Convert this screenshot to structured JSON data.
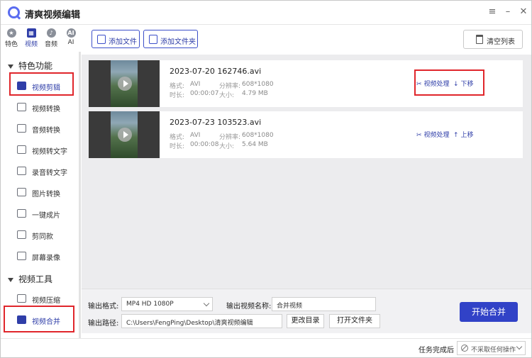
{
  "app": {
    "title": "清爽视频编辑"
  },
  "top_tabs": [
    {
      "label": "特色",
      "icon": "star-icon"
    },
    {
      "label": "视频",
      "icon": "video-icon"
    },
    {
      "label": "音频",
      "icon": "audio-icon"
    },
    {
      "label": "AI",
      "icon": "ai-icon"
    }
  ],
  "sidebar": {
    "sections": [
      {
        "title": "特色功能"
      },
      {
        "title": "视频工具"
      }
    ],
    "features": [
      {
        "label": "视频剪辑"
      },
      {
        "label": "视频转换"
      },
      {
        "label": "音频转换"
      },
      {
        "label": "视频转文字"
      },
      {
        "label": "录音转文字"
      },
      {
        "label": "图片转换"
      },
      {
        "label": "一键成片"
      },
      {
        "label": "剪同款"
      },
      {
        "label": "屏幕录像"
      }
    ],
    "tools": [
      {
        "label": "视频压缩"
      },
      {
        "label": "视频合并"
      }
    ]
  },
  "toolbar": {
    "add_file": "添加文件",
    "add_folder": "添加文件夹",
    "clear_list": "清空列表"
  },
  "files": [
    {
      "name": "2023-07-20 162746.avi",
      "format_label": "格式:",
      "format": "AVI",
      "res_label": "分辨率:",
      "resolution": "608*1080",
      "duration_label": "时长:",
      "duration": "00:00:07",
      "size_label": "大小:",
      "size": "4.79 MB",
      "process": "视频处理",
      "move": "下移"
    },
    {
      "name": "2023-07-23 103523.avi",
      "format_label": "格式:",
      "format": "AVI",
      "res_label": "分辨率:",
      "resolution": "608*1080",
      "duration_label": "时长:",
      "duration": "00:00:08",
      "size_label": "大小:",
      "size": "5.64 MB",
      "process": "视频处理",
      "move": "上移"
    }
  ],
  "output": {
    "format_label": "输出格式:",
    "format_value": "MP4  HD 1080P",
    "name_label": "输出视频名称:",
    "name_value": "合并视频",
    "path_label": "输出路径:",
    "path_value": "C:\\Users\\FengPing\\Desktop\\清爽视频编辑",
    "change_dir": "更改目录",
    "open_folder": "打开文件夹",
    "start": "开始合并"
  },
  "status": {
    "label": "任务完成后",
    "value": "不采取任何操作"
  },
  "colors": {
    "accent": "#3142c7",
    "highlight_box": "#e0262b"
  }
}
